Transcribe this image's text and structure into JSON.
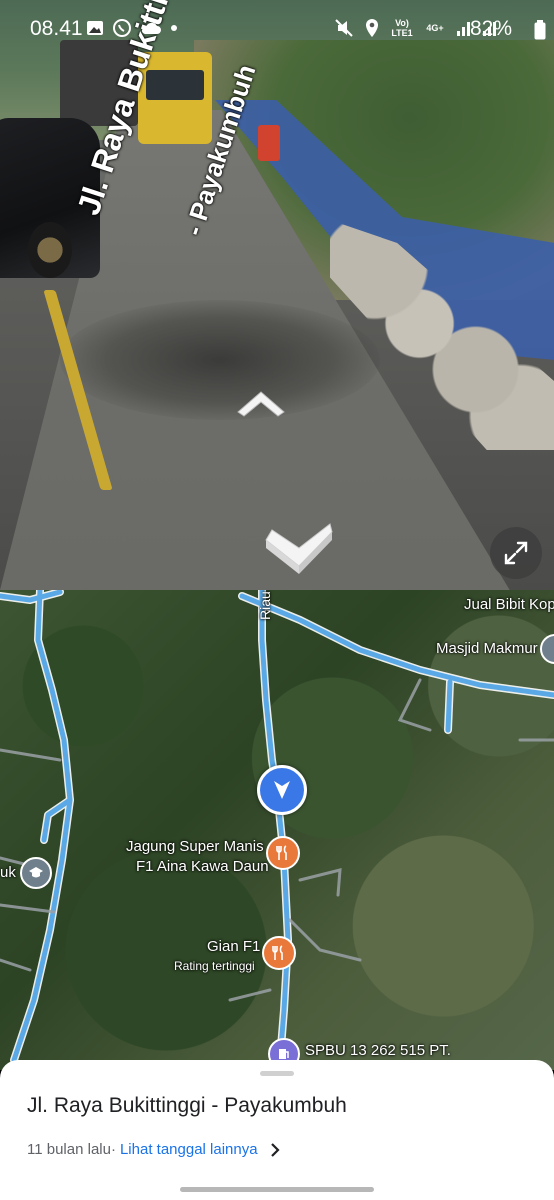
{
  "status_bar": {
    "time": "08.41",
    "network_lte": "Vo) LTE1",
    "network_4g": "4G+",
    "battery": "82%"
  },
  "street_view": {
    "road_name_line1": "Jl. Raya Bukittinggi",
    "road_name_line2": "- Payakumbuh",
    "nav_up_icon": "chevron-up-icon",
    "nav_down_icon": "chevron-down-icon",
    "expand_icon": "expand-icon"
  },
  "map": {
    "labels": {
      "road_riau": "Riau",
      "jual_bibit": "Jual Bibit Kop",
      "masjid": "Masjid Makmur",
      "jagung_line1": "Jagung Super Manis",
      "jagung_line2": "F1 Aina Kawa Daun",
      "gian": "Gian F1",
      "gian_rating": "Rating tertinggi",
      "spbu": "SPBU 13 262 515 PT.",
      "edu_partial": "uk"
    },
    "colors": {
      "road": "#5aa9e6",
      "poi_food": "#e8793a",
      "you_marker": "#3b78e7"
    }
  },
  "sheet": {
    "title": "Jl. Raya Bukittinggi - Payakumbuh",
    "date": "11 bulan lalu",
    "separator": " · ",
    "link": "Lihat tanggal lainnya"
  }
}
